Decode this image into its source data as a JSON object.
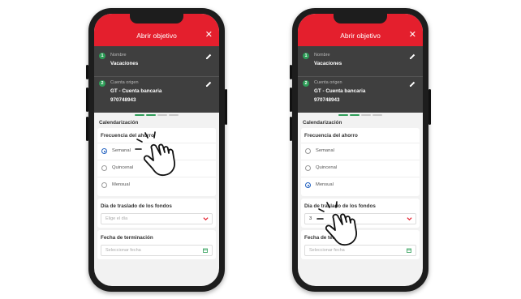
{
  "colors": {
    "header": "#e41f2d",
    "step_badge": "#2e9e58",
    "dark_panel": "#3f3f3f",
    "selected_radio": "#1f5fbf"
  },
  "phones": [
    {
      "header": {
        "title": "Abrir objetivo",
        "close": "✕"
      },
      "fields": [
        {
          "step": "1",
          "label": "Nombre",
          "value": "Vacaciones",
          "icon": "pencil-icon"
        },
        {
          "step": "2",
          "label": "Cuenta origen",
          "value_line1": "GT - Cuenta bancaria",
          "value_line2": "970748943",
          "icon": "pencil-icon"
        }
      ],
      "section_title": "Calendarización",
      "frequency": {
        "title": "Frecuencia del ahorro",
        "options": [
          "Semanal",
          "Quincenal",
          "Mensual"
        ],
        "selected": "Semanal"
      },
      "transfer_day": {
        "label": "Día de traslado de los fondos",
        "placeholder": "Elige el día",
        "value": "",
        "icon": "chevron-down-icon"
      },
      "end_date": {
        "label": "Fecha de terminación",
        "placeholder": "Seleccionar fecha",
        "icon": "calendar-icon"
      },
      "pointer": "tap-hand-icon"
    },
    {
      "header": {
        "title": "Abrir objetivo",
        "close": "✕"
      },
      "fields": [
        {
          "step": "1",
          "label": "Nombre",
          "value": "Vacaciones",
          "icon": "pencil-icon"
        },
        {
          "step": "2",
          "label": "Cuenta origen",
          "value_line1": "GT - Cuenta bancaria",
          "value_line2": "970748943",
          "icon": "pencil-icon"
        }
      ],
      "section_title": "Calendarización",
      "frequency": {
        "title": "Frecuencia del ahorro",
        "options": [
          "Semanal",
          "Quincenal",
          "Mensual"
        ],
        "selected": "Mensual"
      },
      "transfer_day": {
        "label": "Día de traslado de los fondos",
        "placeholder": "",
        "value": "3",
        "icon": "chevron-down-icon"
      },
      "end_date": {
        "label": "Fecha de term",
        "placeholder": "Seleccionar fecha",
        "icon": "calendar-icon"
      },
      "pointer": "tap-hand-icon"
    }
  ]
}
